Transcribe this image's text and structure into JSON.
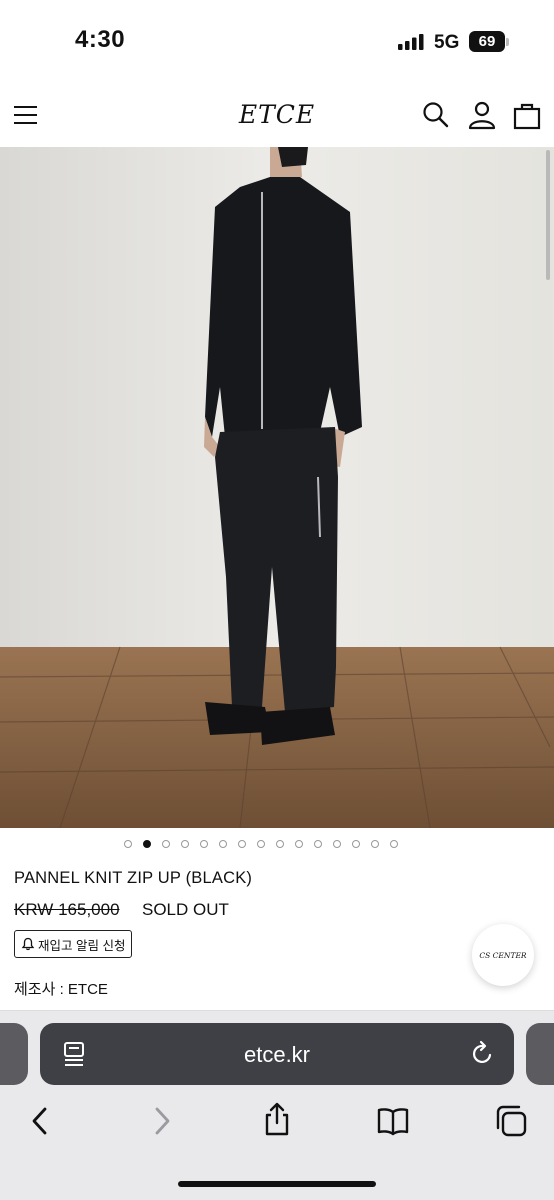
{
  "status_bar": {
    "time": "4:30",
    "network": "5G",
    "battery": "69"
  },
  "header": {
    "logo": "ETCE"
  },
  "gallery": {
    "total_images": 15,
    "active_index": 1
  },
  "product": {
    "name": "PANNEL KNIT ZIP UP (BLACK)",
    "price": "KRW 165,000",
    "status": "SOLD OUT",
    "restock_label": "재입고 알림 신청",
    "manufacturer": "제조사 : ETCE"
  },
  "cs_button": {
    "label": "CS CENTER"
  },
  "browser": {
    "url": "etce.kr"
  },
  "icons": [
    "menu-icon",
    "search-icon",
    "account-icon",
    "cart-icon",
    "bell-icon",
    "reader-icon",
    "reload-icon",
    "back-icon",
    "forward-icon",
    "share-icon",
    "bookmarks-icon",
    "tabs-icon"
  ]
}
